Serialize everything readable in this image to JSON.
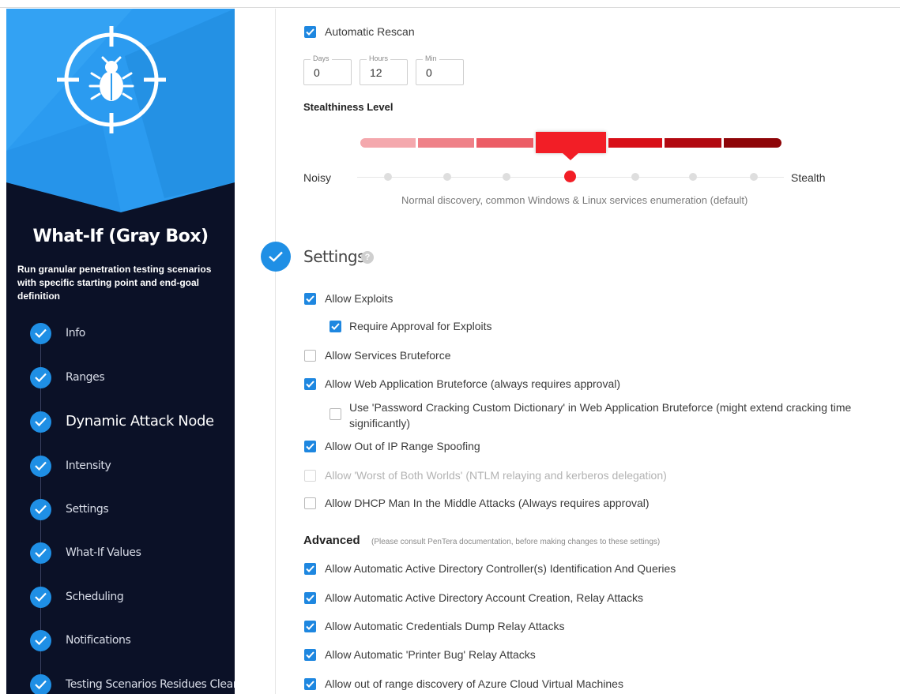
{
  "sidebar": {
    "title": "What-If (Gray Box)",
    "description": "Run granular penetration testing scenarios with specific starting point and end-goal definition",
    "steps": [
      {
        "label": "Info"
      },
      {
        "label": "Ranges"
      },
      {
        "label": "Dynamic Attack Node"
      },
      {
        "label": "Intensity"
      },
      {
        "label": "Settings"
      },
      {
        "label": "What-If Values"
      },
      {
        "label": "Scheduling"
      },
      {
        "label": "Notifications"
      },
      {
        "label": "Testing Scenarios Residues Cleanup"
      }
    ]
  },
  "rescan": {
    "label": "Automatic Rescan",
    "checked": true,
    "days_label": "Days",
    "days_value": "0",
    "hours_label": "Hours",
    "hours_value": "12",
    "min_label": "Min",
    "min_value": "0"
  },
  "stealth": {
    "heading": "Stealthiness Level",
    "left_label": "Noisy",
    "right_label": "Stealth",
    "selected_level": 4,
    "levels": 7,
    "description": "Normal discovery, common Windows & Linux services enumeration (default)",
    "colors": [
      "#f4a8ad",
      "#ef8188",
      "#ec5d66",
      "#f21e26",
      "#d80f18",
      "#b20911",
      "#8e0508"
    ]
  },
  "settings": {
    "heading": "Settings",
    "help": "?",
    "options": [
      {
        "label": "Allow Exploits",
        "checked": true
      },
      {
        "label": "Require Approval for Exploits",
        "checked": true
      },
      {
        "label": "Allow Services Bruteforce",
        "checked": false
      },
      {
        "label": "Allow Web Application Bruteforce (always requires approval)",
        "checked": true
      },
      {
        "label": "Use 'Password Cracking Custom Dictionary' in Web Application Bruteforce (might extend cracking time significantly)",
        "checked": false
      },
      {
        "label": "Allow Out of IP Range Spoofing",
        "checked": true
      },
      {
        "label": "Allow 'Worst of Both Worlds' (NTLM relaying and kerberos delegation)",
        "checked": false,
        "disabled": true
      },
      {
        "label": "Allow DHCP Man In the Middle Attacks (Always requires approval)",
        "checked": false
      }
    ]
  },
  "advanced": {
    "heading": "Advanced",
    "note": "(Please consult PenTera documentation, before making changes to these settings)",
    "options": [
      {
        "label": "Allow Automatic Active Directory Controller(s) Identification And Queries",
        "checked": true
      },
      {
        "label": "Allow Automatic Active Directory Account Creation, Relay Attacks",
        "checked": true
      },
      {
        "label": "Allow Automatic Credentials Dump Relay Attacks",
        "checked": true
      },
      {
        "label": "Allow Automatic 'Printer Bug' Relay Attacks",
        "checked": true
      },
      {
        "label": "Allow out of range discovery of Azure Cloud Virtual Machines",
        "checked": true
      }
    ]
  }
}
